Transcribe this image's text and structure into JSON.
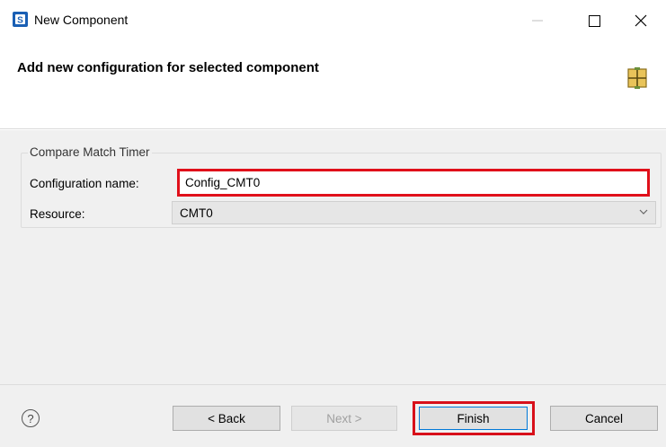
{
  "window": {
    "title": "New Component",
    "controls": {
      "minimize": "—",
      "maximize": "☐",
      "close": "✕"
    }
  },
  "header": {
    "title": "Add new configuration for selected component"
  },
  "group": {
    "label": "Compare Match Timer",
    "fields": {
      "config_name_label": "Configuration name:",
      "config_name_value": "Config_CMT0",
      "resource_label": "Resource:",
      "resource_value": "CMT0"
    }
  },
  "footer": {
    "help": "?",
    "back_label": "< Back",
    "next_label": "Next >",
    "finish_label": "Finish",
    "cancel_label": "Cancel"
  },
  "colors": {
    "highlight": "#e0101a",
    "app_icon": "#1a5fb4",
    "header_icon": "#c9a227"
  }
}
